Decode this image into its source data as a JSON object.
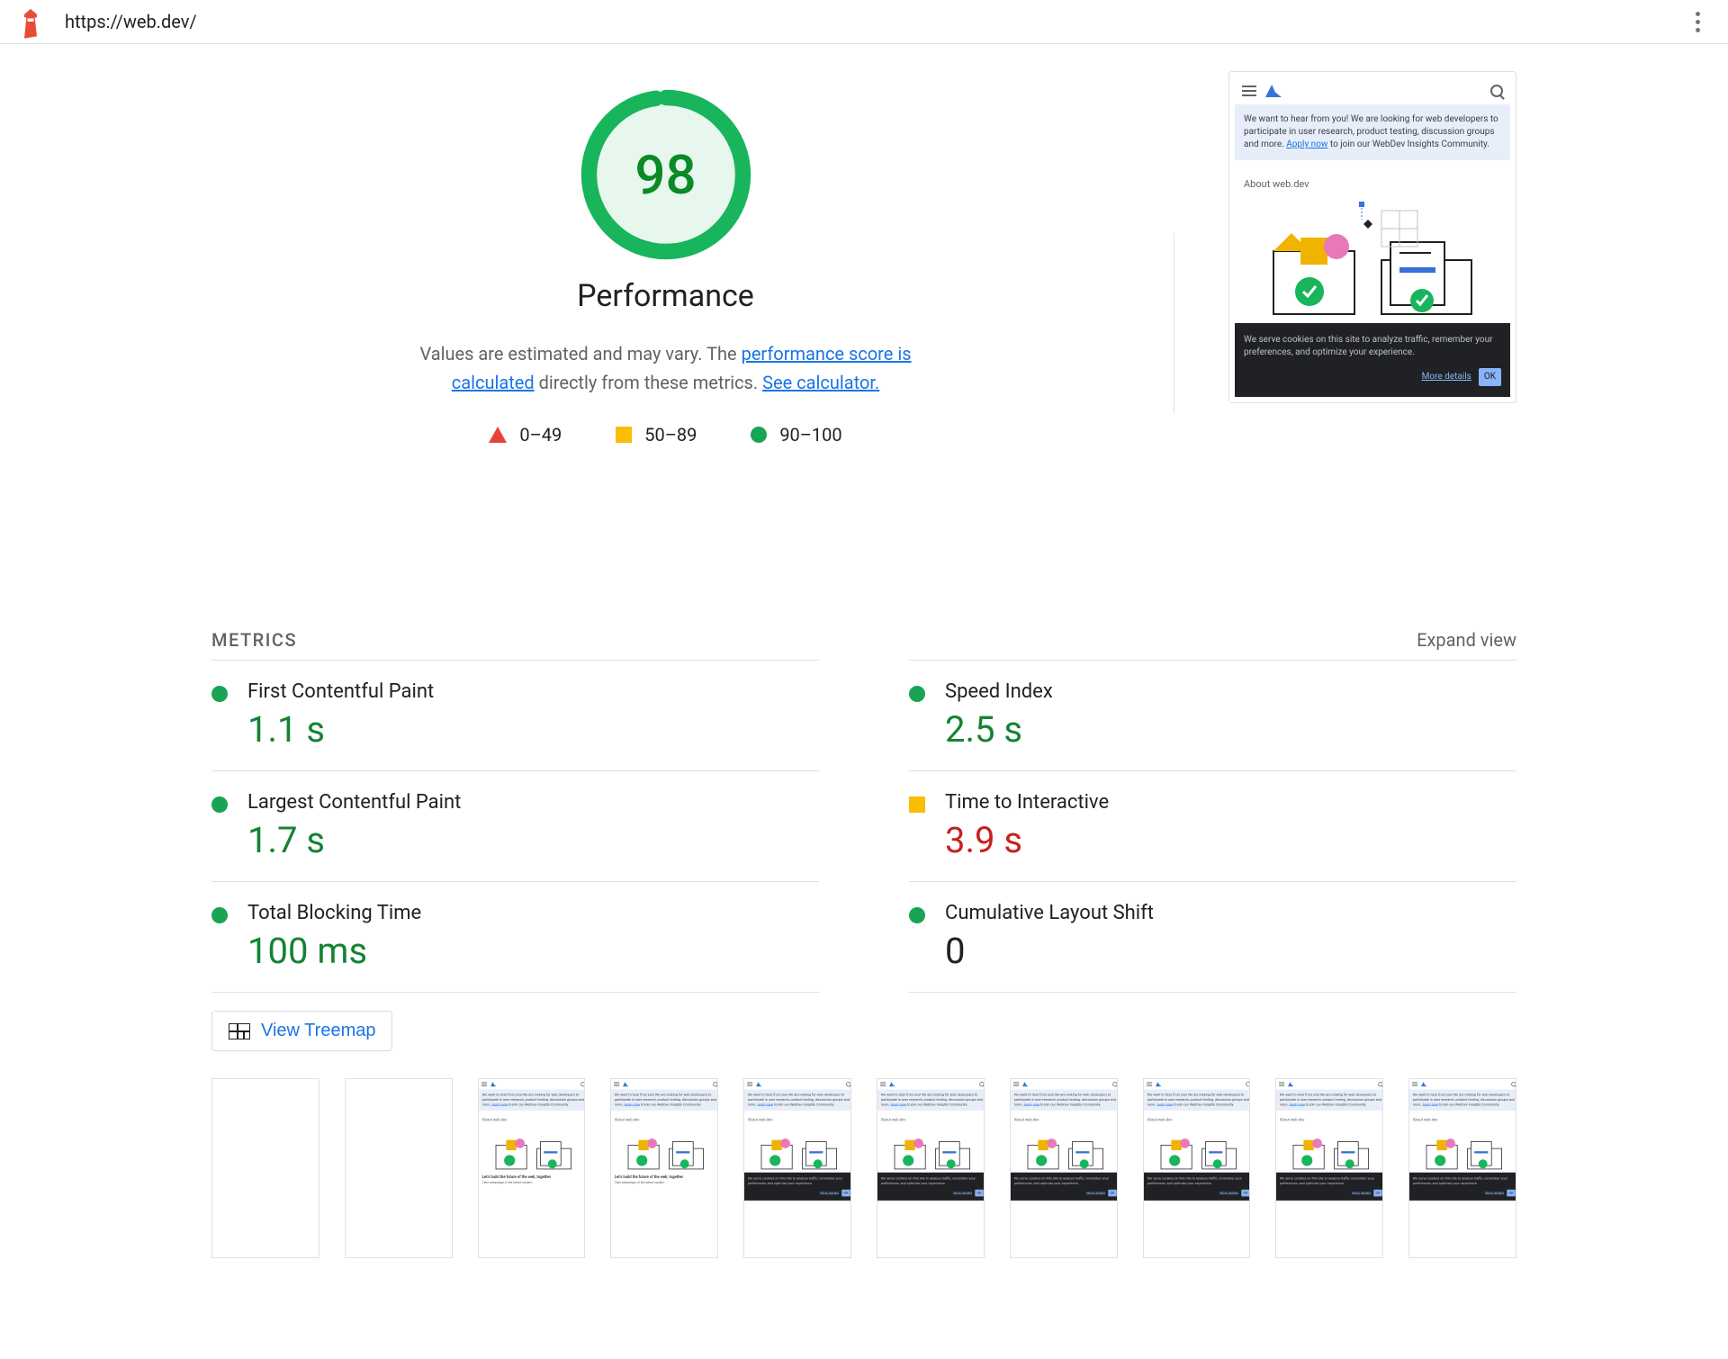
{
  "header": {
    "url": "https://web.dev/"
  },
  "gauge": {
    "score": "98",
    "title": "Performance",
    "desc_prefix": "Values are estimated and may vary. The ",
    "link1": "performance score is calculated",
    "desc_mid": " directly from these metrics. ",
    "link2": "See calculator."
  },
  "legend": {
    "r0": "0–49",
    "r1": "50–89",
    "r2": "90–100"
  },
  "preview": {
    "banner_text": "We want to hear from you! We are looking for web developers to participate in user research, product testing, discussion groups and more. ",
    "banner_link": "Apply now",
    "banner_suffix": " to join our WebDev Insights Community.",
    "about": "About web.dev",
    "cookie_text": "We serve cookies on this site to analyze traffic, remember your preferences, and optimize your experience.",
    "more_details": "More details",
    "ok": "OK",
    "tagline": "Let's build the future of the web, together",
    "subline": "Take advantage of the latest modern"
  },
  "metrics_section": {
    "title": "METRICS",
    "expand": "Expand view"
  },
  "metrics": [
    {
      "name": "First Contentful Paint",
      "value": "1.1 s",
      "status": "green"
    },
    {
      "name": "Speed Index",
      "value": "2.5 s",
      "status": "green"
    },
    {
      "name": "Largest Contentful Paint",
      "value": "1.7 s",
      "status": "green"
    },
    {
      "name": "Time to Interactive",
      "value": "3.9 s",
      "status": "orange"
    },
    {
      "name": "Total Blocking Time",
      "value": "100 ms",
      "status": "green"
    },
    {
      "name": "Cumulative Layout Shift",
      "value": "0",
      "status": "neutral",
      "dot": "green"
    }
  ],
  "treemap": {
    "label": "View Treemap"
  }
}
